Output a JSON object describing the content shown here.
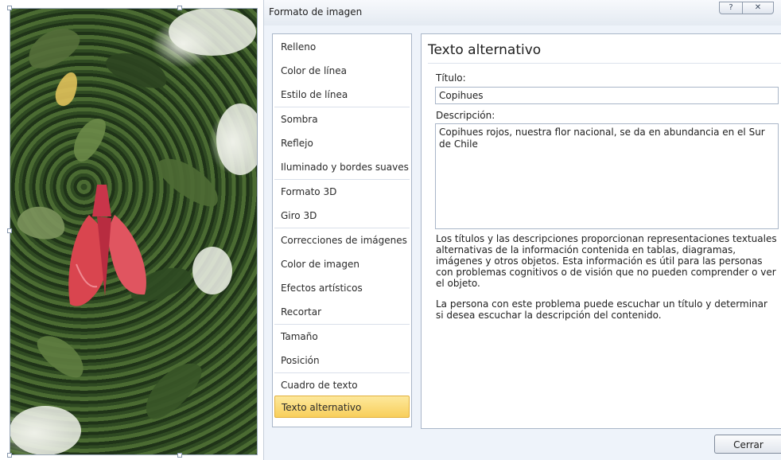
{
  "dialog": {
    "title": "Formato de imagen",
    "help_icon": "?",
    "close_icon": "✕"
  },
  "nav": {
    "items": [
      {
        "label": "Relleno"
      },
      {
        "label": "Color de línea"
      },
      {
        "label": "Estilo de línea"
      },
      {
        "label": "Sombra"
      },
      {
        "label": "Reflejo"
      },
      {
        "label": "Iluminado y bordes suaves"
      },
      {
        "label": "Formato 3D"
      },
      {
        "label": "Giro 3D"
      },
      {
        "label": "Correcciones de imágenes"
      },
      {
        "label": "Color de imagen"
      },
      {
        "label": "Efectos artísticos"
      },
      {
        "label": "Recortar"
      },
      {
        "label": "Tamaño"
      },
      {
        "label": "Posición"
      },
      {
        "label": "Cuadro de texto"
      },
      {
        "label": "Texto alternativo"
      }
    ],
    "selected": "Texto alternativo"
  },
  "panel": {
    "heading": "Texto alternativo",
    "title_label": "Título:",
    "title_value": "Copihues",
    "description_label": "Descripción:",
    "description_value": "Copihues rojos, nuestra flor nacional, se da en abundancia en el Sur de Chile",
    "help_paragraph_1": "Los títulos y las descripciones proporcionan representaciones textuales alternativas de la información contenida en tablas, diagramas, imágenes y otros objetos. Esta información es útil para las personas con problemas cognitivos o de visión que no pueden comprender o ver el objeto.",
    "help_paragraph_2": "La persona con este problema puede escuchar un título y determinar si desea escuchar la descripción del contenido."
  },
  "footer": {
    "close_button": "Cerrar"
  },
  "colors": {
    "selected_item": "#f8cf5b",
    "flower": "#d9454f",
    "foliage": "#3d5a2a"
  }
}
